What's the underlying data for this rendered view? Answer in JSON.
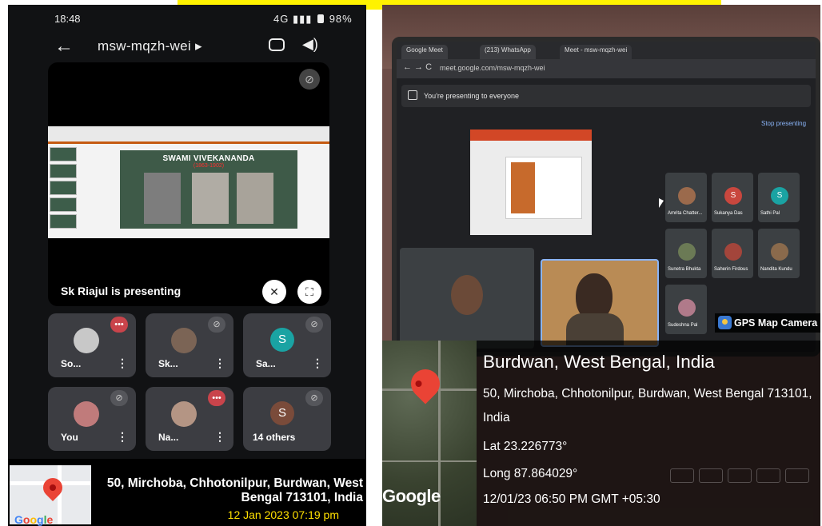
{
  "phone": {
    "status": {
      "time": "18:48",
      "network": "4G",
      "battery": "98%"
    },
    "meeting_code": "msw-mqzh-wei",
    "presenter": "Sk Riajul is presenting",
    "slide": {
      "title": "SWAMI VIVEKANANDA",
      "subtitle": "(1863-1902)"
    },
    "participants": [
      {
        "name": "So...",
        "kind": "photo",
        "badge": "red"
      },
      {
        "name": "Sk...",
        "kind": "photo",
        "badge": "muted"
      },
      {
        "name": "Sa...",
        "kind": "letter",
        "letter": "S",
        "color": "#1aa3a3",
        "badge": "muted"
      },
      {
        "name": "You",
        "kind": "photo",
        "badge": "muted"
      },
      {
        "name": "Na...",
        "kind": "photo",
        "badge": "red"
      },
      {
        "name": "S",
        "kind": "letter",
        "letter": "S",
        "color": "#7a4b3a",
        "badge": "muted",
        "others": "14 others"
      }
    ],
    "geotag": {
      "address": "50, Mirchoba, Chhotonilpur, Burdwan, West Bengal 713101, India",
      "datetime": "12 Jan 2023 07:19 pm",
      "map_brand": "Google"
    }
  },
  "laptop": {
    "tabs": [
      "Google Meet",
      "(213) WhatsApp",
      "Meet - msw-mqzh-wei"
    ],
    "url": "meet.google.com/msw-mqzh-wei",
    "presenting_banner": "You're presenting to everyone",
    "stop_presenting": "Stop presenting",
    "participants": [
      {
        "name": "Amrita Chatter...",
        "kind": "photo"
      },
      {
        "name": "Sukanya Das",
        "kind": "letter",
        "letter": "S",
        "color": "#c9473e"
      },
      {
        "name": "Sathi Pal",
        "kind": "letter",
        "letter": "S",
        "color": "#1aa3a3"
      },
      {
        "name": "Sunetra Bhukta",
        "kind": "photo"
      },
      {
        "name": "Saherin Firdous",
        "kind": "photo"
      },
      {
        "name": "Nandita Kundu",
        "kind": "photo"
      },
      {
        "name": "Sudeshna Pal",
        "kind": "photo"
      }
    ]
  },
  "gps_camera_label": "GPS Map Camera",
  "geo": {
    "title": "Burdwan, West Bengal, India",
    "address_line1": "50, Mirchoba, Chhotonilpur, Burdwan, West Bengal 713101,",
    "address_line2": "India",
    "lat": "Lat 23.226773°",
    "long": "Long 87.864029°",
    "datetime": "12/01/23 06:50 PM GMT +05:30",
    "map_brand": "Google"
  }
}
